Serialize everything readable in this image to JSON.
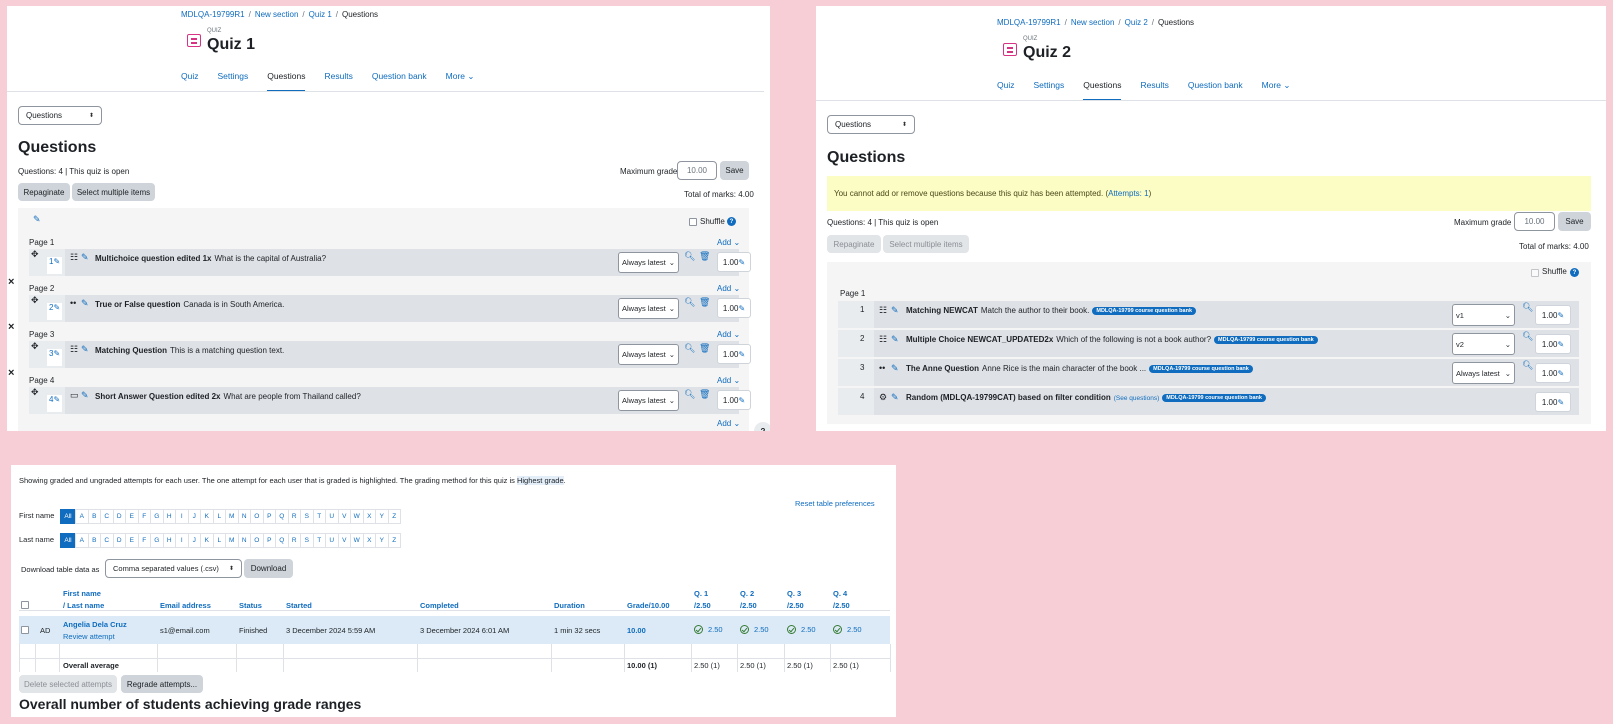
{
  "quiz1": {
    "breadcrumb": [
      "MDLQA-19799R1",
      "New section",
      "Quiz 1",
      "Questions"
    ],
    "kind": "QUIZ",
    "title": "Quiz 1",
    "tabs": [
      "Quiz",
      "Settings",
      "Questions",
      "Results",
      "Question bank",
      "More"
    ],
    "jump": "Questions",
    "heading": "Questions",
    "info": "Questions: 4 | This quiz is open",
    "max_grade_label": "Maximum grade",
    "max_grade": "10.00",
    "save": "Save",
    "repaginate": "Repaginate",
    "select_multiple": "Select multiple items",
    "total": "Total of marks: 4.00",
    "shuffle": "Shuffle",
    "add": "Add",
    "pages": [
      "Page 1",
      "Page 2",
      "Page 3",
      "Page 4"
    ],
    "questions": [
      {
        "num": "1",
        "name": "Multichoice question edited 1x",
        "text": "What is the capital of Australia?",
        "version": "Always latest",
        "mark": "1.00"
      },
      {
        "num": "2",
        "name": "True or False question",
        "text": "Canada is in South America.",
        "version": "Always latest",
        "mark": "1.00"
      },
      {
        "num": "3",
        "name": "Matching Question",
        "text": "This is a matching question text.",
        "version": "Always latest",
        "mark": "1.00"
      },
      {
        "num": "4",
        "name": "Short Answer Question edited 2x",
        "text": "What are people from Thailand called?",
        "version": "Always latest",
        "mark": "1.00"
      }
    ]
  },
  "quiz2": {
    "breadcrumb": [
      "MDLQA-19799R1",
      "New section",
      "Quiz 2",
      "Questions"
    ],
    "kind": "QUIZ",
    "title": "Quiz 2",
    "tabs": [
      "Quiz",
      "Settings",
      "Questions",
      "Results",
      "Question bank",
      "More"
    ],
    "jump": "Questions",
    "heading": "Questions",
    "warning": "You cannot add or remove questions because this quiz has been attempted. (",
    "attempts_link": "Attempts: 1",
    "warning_end": ")",
    "info": "Questions: 4 | This quiz is open",
    "max_grade_label": "Maximum grade",
    "max_grade": "10.00",
    "save": "Save",
    "repaginate": "Repaginate",
    "select_multiple": "Select multiple items",
    "total": "Total of marks: 4.00",
    "shuffle": "Shuffle",
    "page": "Page 1",
    "questions": [
      {
        "num": "1",
        "name": "Matching NEWCAT",
        "text": "Match the author to their book.",
        "badge": "MDLQA-19799 course question bank",
        "version": "v1",
        "mark": "1.00"
      },
      {
        "num": "2",
        "name": "Multiple Choice NEWCAT_UPDATED2x",
        "text": "Which of the following is not a book author?",
        "badge": "MDLQA-19799 course question bank",
        "version": "v2",
        "mark": "1.00"
      },
      {
        "num": "3",
        "name": "The Anne Question",
        "text": "Anne Rice is the main character of the book ...",
        "badge": "MDLQA-19799 course question bank",
        "version": "Always latest",
        "mark": "1.00"
      },
      {
        "num": "4",
        "name": "Random (MDLQA-19799CAT) based on filter condition",
        "see": "(See questions)",
        "badge": "MDLQA-19799 course question bank",
        "mark": "1.00"
      }
    ]
  },
  "results": {
    "intro": "Showing graded and ungraded attempts for each user. The one attempt for each user that is graded is highlighted. The grading method for this quiz is ",
    "grading_method": "Highest grade",
    "intro_end": ".",
    "reset": "Reset table preferences",
    "first_name_label": "First name",
    "last_name_label": "Last name",
    "letters": [
      "All",
      "A",
      "B",
      "C",
      "D",
      "E",
      "F",
      "G",
      "H",
      "I",
      "J",
      "K",
      "L",
      "M",
      "N",
      "O",
      "P",
      "Q",
      "R",
      "S",
      "T",
      "U",
      "V",
      "W",
      "X",
      "Y",
      "Z"
    ],
    "download_label": "Download table data as",
    "download_format": "Comma separated values (.csv)",
    "download_btn": "Download",
    "headers": {
      "first": "First name",
      "last": "/ Last name",
      "email": "Email address",
      "status": "Status",
      "started": "Started",
      "completed": "Completed",
      "duration": "Duration",
      "grade": "Grade/10.00",
      "q1": "Q. 1",
      "q2": "Q. 2",
      "q3": "Q. 3",
      "q4": "Q. 4",
      "qmax": "/2.50"
    },
    "row": {
      "initials": "AD",
      "name": "Angelia Dela Cruz",
      "review": "Review attempt",
      "email": "s1@email.com",
      "status": "Finished",
      "started": "3 December 2024 5:59 AM",
      "completed": "3 December 2024 6:01 AM",
      "duration": "1 min 32 secs",
      "grade": "10.00",
      "q": [
        "2.50",
        "2.50",
        "2.50",
        "2.50"
      ]
    },
    "avg": {
      "label": "Overall average",
      "grade": "10.00 (1)",
      "q": [
        "2.50 (1)",
        "2.50 (1)",
        "2.50 (1)",
        "2.50 (1)"
      ]
    },
    "delete_btn": "Delete selected attempts",
    "regrade_btn": "Regrade attempts...",
    "subheading": "Overall number of students achieving grade ranges"
  }
}
